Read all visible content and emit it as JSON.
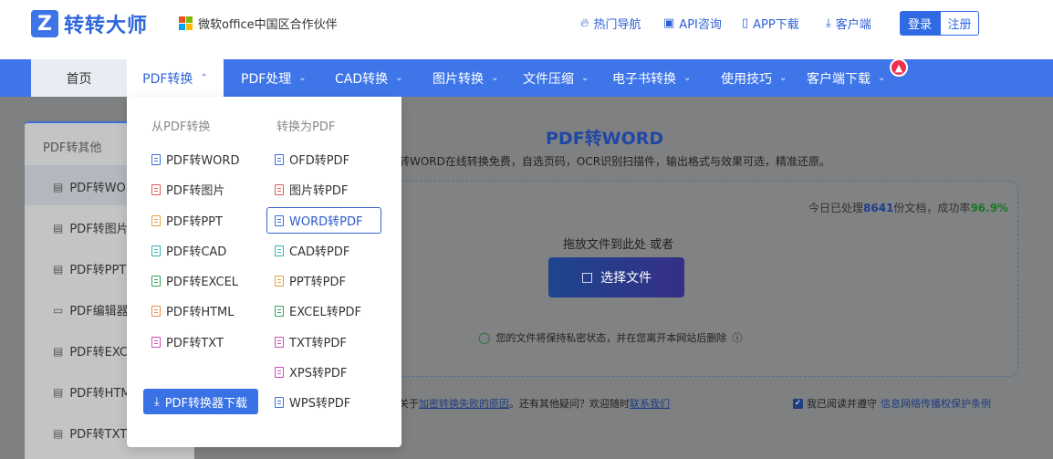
{
  "brand": {
    "name": "转转大师",
    "logo_letter": "Z",
    "partner": "微软office中国区合作伙伴"
  },
  "topnav": [
    {
      "icon": "fire-icon",
      "label": "热门导航"
    },
    {
      "icon": "chat-icon",
      "label": "API咨询"
    },
    {
      "icon": "phone-icon",
      "label": "APP下载"
    },
    {
      "icon": "download-icon",
      "label": "客户端"
    }
  ],
  "auth": {
    "login": "登录",
    "register": "注册"
  },
  "nav": {
    "home": "首页",
    "items": [
      "PDF转换",
      "PDF处理",
      "CAD转换",
      "图片转换",
      "文件压缩",
      "电子书转换",
      "使用技巧",
      "客户端下载"
    ]
  },
  "dropdown": {
    "from_pdf_title": "从PDF转换",
    "to_pdf_title": "转换为PDF",
    "from_pdf": [
      {
        "label": "PDF转WORD",
        "color": "#3a6fe0"
      },
      {
        "label": "PDF转图片",
        "color": "#e05a4e"
      },
      {
        "label": "PDF转PPT",
        "color": "#e8a23a"
      },
      {
        "label": "PDF转CAD",
        "color": "#34b1b1"
      },
      {
        "label": "PDF转EXCEL",
        "color": "#2fa55a"
      },
      {
        "label": "PDF转HTML",
        "color": "#e88a4a"
      },
      {
        "label": "PDF转TXT",
        "color": "#c84fb7"
      }
    ],
    "to_pdf": [
      {
        "label": "OFD转PDF",
        "color": "#3a6fe0"
      },
      {
        "label": "图片转PDF",
        "color": "#e05a4e"
      },
      {
        "label": "WORD转PDF",
        "color": "#3a6fe0"
      },
      {
        "label": "CAD转PDF",
        "color": "#34b1b1"
      },
      {
        "label": "PPT转PDF",
        "color": "#e8a23a"
      },
      {
        "label": "EXCEL转PDF",
        "color": "#2fa55a"
      },
      {
        "label": "TXT转PDF",
        "color": "#c84fb7"
      },
      {
        "label": "XPS转PDF",
        "color": "#c84fb7"
      },
      {
        "label": "WPS转PDF",
        "color": "#3a6fe0"
      }
    ],
    "download_button": "PDF转换器下载"
  },
  "sidebar": {
    "title": "PDF转其他",
    "items": [
      "PDF转WO",
      "PDF转图片",
      "PDF转PPT",
      "PDF编辑器",
      "PDF转EXC",
      "PDF转HTM",
      "PDF转TXT"
    ]
  },
  "main": {
    "title": "PDF转WORD",
    "description": "转WORD在线转换免费，自选页码，OCR识别扫描件，输出格式与效果可选，精准还原。",
    "stats_prefix": "今日已处理",
    "stats_count": "8641",
    "stats_mid": "份文档，成功率",
    "stats_rate": "96.9%",
    "drop_text": "拖放文件到此处 或者",
    "choose_button": "选择文件",
    "privacy": "您的文件将保持私密状态，并在您离开本网站后删除",
    "help_prefix": "关于",
    "help_link": "加密转换失败的原因",
    "help_mid": "。还有其他疑问？欢迎随时",
    "help_contact": "联系我们",
    "agree_text": "我已阅读并遵守",
    "agree_link": "信息网络传播权保护条例"
  }
}
